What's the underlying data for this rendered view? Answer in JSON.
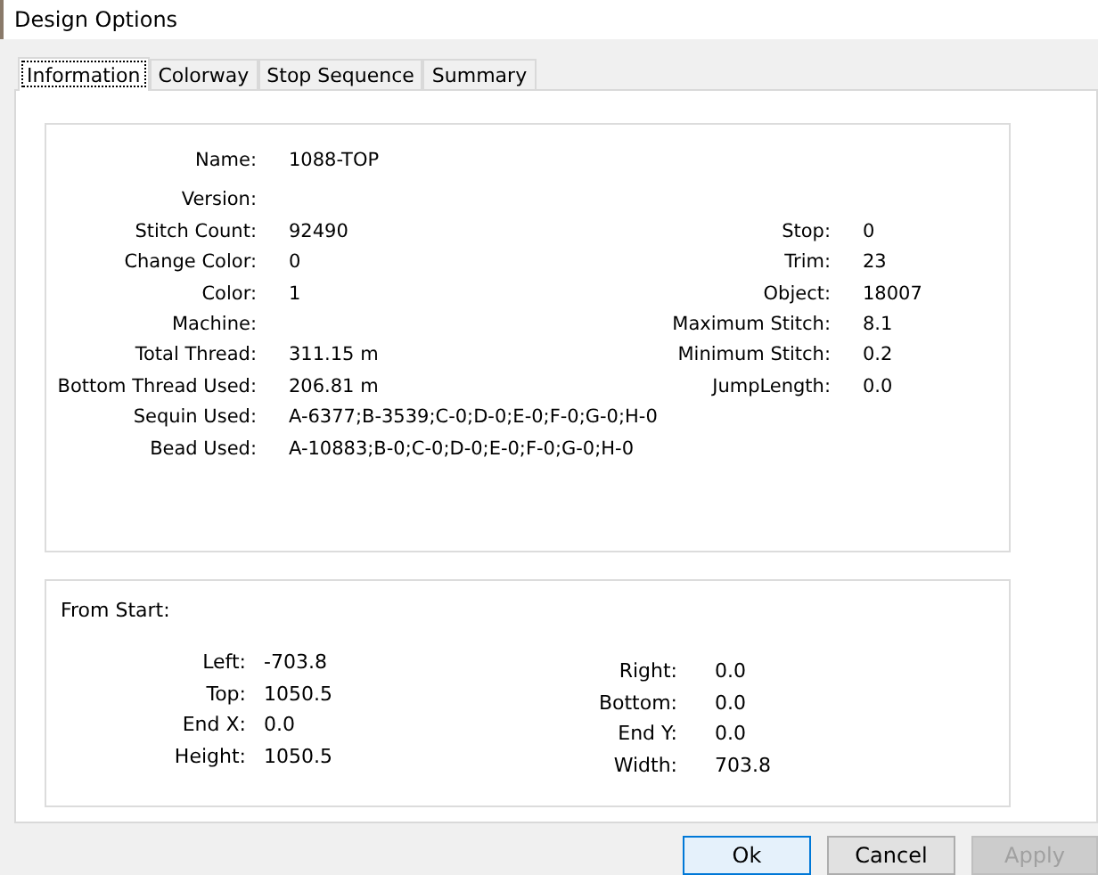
{
  "window": {
    "title": "Design Options"
  },
  "tabs": [
    {
      "label": "Information",
      "selected": true
    },
    {
      "label": "Colorway",
      "selected": false
    },
    {
      "label": "Stop Sequence",
      "selected": false
    },
    {
      "label": "Summary",
      "selected": false
    }
  ],
  "information": {
    "rows": [
      {
        "label": "Name:",
        "value": "1088-TOP"
      },
      {
        "label": "Version:",
        "value": ""
      },
      {
        "label": "Stitch Count:",
        "value": "92490",
        "label2": "Stop:",
        "value2": "0"
      },
      {
        "label": "Change Color:",
        "value": "0",
        "label2": "Trim:",
        "value2": "23"
      },
      {
        "label": "Color:",
        "value": "1",
        "label2": "Object:",
        "value2": "18007"
      },
      {
        "label": "Machine:",
        "value": "",
        "label2": "Maximum Stitch:",
        "value2": "8.1"
      },
      {
        "label": "Total Thread:",
        "value": "311.15 m",
        "label2": "Minimum Stitch:",
        "value2": "0.2"
      },
      {
        "label": "Bottom Thread Used:",
        "value": "206.81 m",
        "label2": "JumpLength:",
        "value2": "0.0"
      },
      {
        "label": "Sequin Used:",
        "value": "A-6377;B-3539;C-0;D-0;E-0;F-0;G-0;H-0"
      },
      {
        "label": "Bead Used:",
        "value": "A-10883;B-0;C-0;D-0;E-0;F-0;G-0;H-0"
      }
    ]
  },
  "from_start": {
    "title": "From Start:",
    "left": [
      {
        "label": "Left:",
        "value": "-703.8"
      },
      {
        "label": "Top:",
        "value": "1050.5"
      },
      {
        "label": "End X:",
        "value": "0.0"
      },
      {
        "label": "Height:",
        "value": "1050.5"
      }
    ],
    "right": [
      {
        "label": "Right:",
        "value": "0.0"
      },
      {
        "label": "Bottom:",
        "value": "0.0"
      },
      {
        "label": "End Y:",
        "value": "0.0"
      },
      {
        "label": "Width:",
        "value": "703.8"
      }
    ]
  },
  "buttons": [
    {
      "label": "Ok",
      "disabled": false,
      "default": true
    },
    {
      "label": "Cancel",
      "disabled": false,
      "default": false
    },
    {
      "label": "Apply",
      "disabled": true,
      "default": false
    }
  ]
}
